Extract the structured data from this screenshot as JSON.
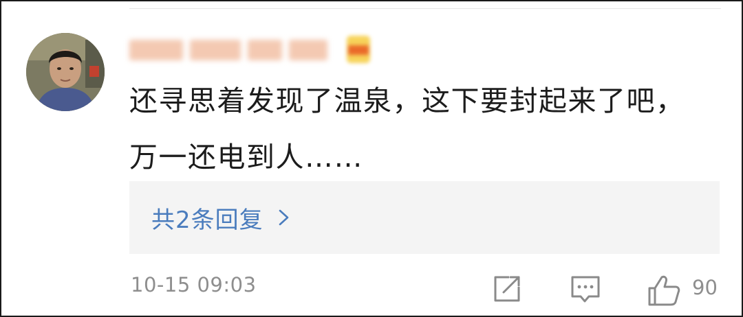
{
  "comment": {
    "text": "还寻思着发现了温泉，这下要封起来了吧，万一还电到人……",
    "replies_label": "共2条回复",
    "timestamp": "10-15 09:03",
    "like_count": "90"
  },
  "icons": {
    "share": "share-icon",
    "comment": "comment-icon",
    "like": "thumbs-up-icon",
    "chevron": "chevron-right-icon"
  },
  "colors": {
    "text": "#1c1c1c",
    "link": "#4a7cbd",
    "muted": "#8e8e8e",
    "reply_bg": "#f4f4f4"
  }
}
